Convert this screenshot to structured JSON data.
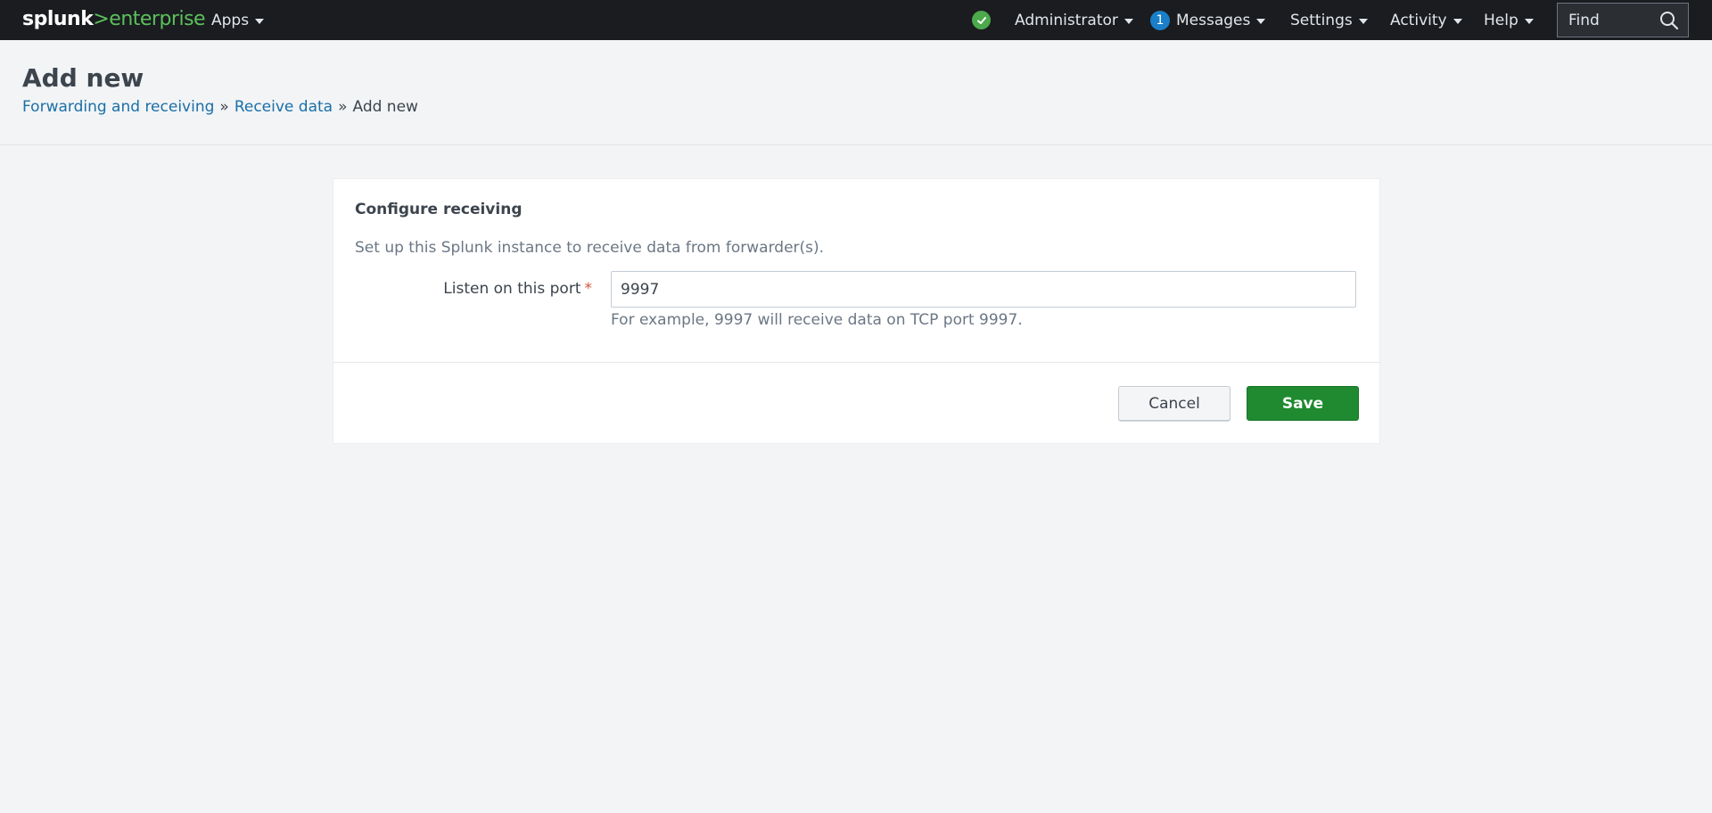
{
  "topbar": {
    "logo": {
      "part1": "splunk",
      "part2": ">",
      "part3": "enterprise"
    },
    "apps_label": "Apps",
    "status_icon": "check-circle-icon",
    "admin_label": "Administrator",
    "messages_count": "1",
    "messages_label": "Messages",
    "settings_label": "Settings",
    "activity_label": "Activity",
    "help_label": "Help",
    "find_placeholder": "Find",
    "colors": {
      "bar": "#1a1c20",
      "brand_green": "#5cc05c",
      "status_green": "#4ca94c",
      "badge_blue": "#1a7ec8"
    }
  },
  "header": {
    "title": "Add new",
    "breadcrumb": [
      {
        "label": "Forwarding and receiving"
      },
      {
        "label": "Receive data"
      },
      {
        "label": "Add new"
      }
    ],
    "separator": "»"
  },
  "form": {
    "title": "Configure receiving",
    "description": "Set up this Splunk instance to receive data from forwarder(s).",
    "port_label": "Listen on this port",
    "required_marker": "*",
    "port_value": "9997",
    "help_text": "For example, 9997 will receive data on TCP port 9997.",
    "cancel_label": "Cancel",
    "save_label": "Save",
    "colors": {
      "save": "#1f8a2f",
      "link": "#1a6fa8"
    }
  }
}
